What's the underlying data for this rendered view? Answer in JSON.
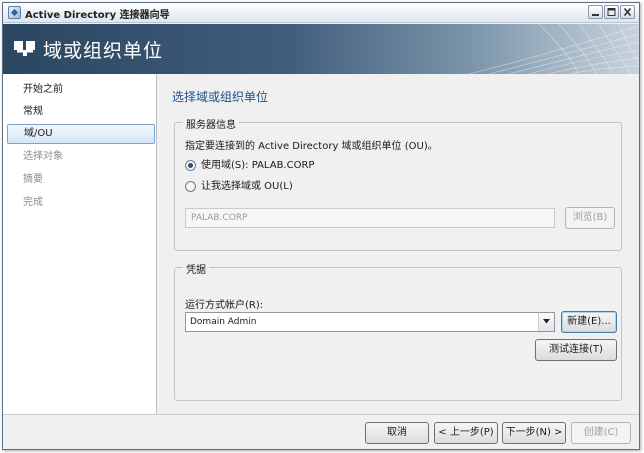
{
  "window": {
    "title": "Active Directory 连接器向导",
    "icon": "wizard-app-icon",
    "controls": [
      "minimize-icon",
      "maximize-icon",
      "close-icon"
    ]
  },
  "banner": {
    "title": "域或组织单位",
    "icon": "domain-ou-icon"
  },
  "nav": {
    "items": [
      {
        "label": "开始之前",
        "state": "done"
      },
      {
        "label": "常规",
        "state": "done"
      },
      {
        "label": "域/OU",
        "state": "active"
      },
      {
        "label": "选择对象",
        "state": "disabled"
      },
      {
        "label": "摘要",
        "state": "disabled"
      },
      {
        "label": "完成",
        "state": "disabled"
      }
    ]
  },
  "main": {
    "heading": "选择域或组织单位",
    "server_group": {
      "title": "服务器信息",
      "description": "指定要连接到的 Active Directory 域或组织单位 (OU)。",
      "radio_use_domain": "使用域(S): PALAB.CORP",
      "radio_choose_ou": "让我选择域或 OU(L)",
      "ou_field_value": "PALAB.CORP",
      "browse_label": "浏览(B)"
    },
    "credentials_group": {
      "title": "凭据",
      "account_label": "运行方式帐户(R):",
      "account_value": "Domain Admin",
      "new_label": "新建(E)...",
      "test_label": "测试连接(T)"
    }
  },
  "footer": {
    "cancel_label": "取消",
    "prev_label": "< 上一步(P)",
    "next_label": "下一步(N) >",
    "create_label": "创建(C)"
  },
  "colors": {
    "heading": "#1f4f8c",
    "banner_dark": "#2b4660",
    "nav_active_border": "#7da2ce"
  }
}
